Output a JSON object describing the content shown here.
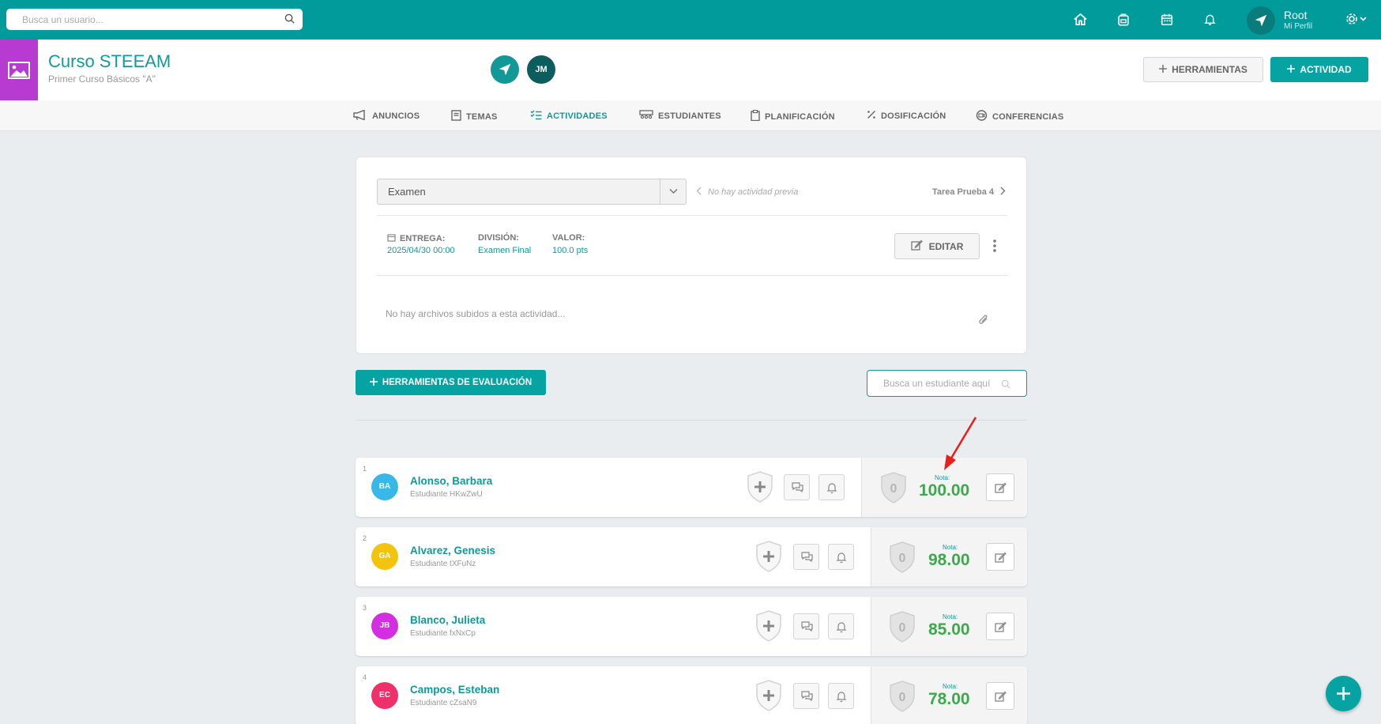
{
  "topbar": {
    "search_placeholder": "Busca un usuario...",
    "user_name": "Root",
    "user_sub": "Mi Perfil",
    "icons": [
      "home-icon",
      "backpack-icon",
      "calendar-icon",
      "bell-icon"
    ]
  },
  "course": {
    "title": "Curso STEEAM",
    "subtitle": "Primer Curso Básicos \"A\"",
    "member_initials": "JM",
    "tools_label": "HERRAMIENTAS",
    "activity_label": "ACTIVIDAD"
  },
  "tabs": [
    {
      "label": "ANUNCIOS",
      "icon": "megaphone-icon"
    },
    {
      "label": "TEMAS",
      "icon": "book-icon"
    },
    {
      "label": "ACTIVIDADES",
      "icon": "checklist-icon",
      "active": true
    },
    {
      "label": "ESTUDIANTES",
      "icon": "students-icon"
    },
    {
      "label": "PLANIFICACIÓN",
      "icon": "clipboard-icon"
    },
    {
      "label": "DOSIFICACIÓN",
      "icon": "percent-icon"
    },
    {
      "label": "CONFERENCIAS",
      "icon": "video-icon"
    }
  ],
  "activity": {
    "type_selected": "Examen",
    "prev_text": "No hay actividad previa",
    "next_text": "Tarea Prueba 4",
    "entrega_label": "ENTREGA:",
    "entrega_value": "2025/04/30 00:00",
    "division_label": "DIVISIÓN:",
    "division_value": "Examen Final",
    "valor_label": "VALOR:",
    "valor_value": "100.0 pts",
    "edit_label": "EDITAR",
    "no_files": "No hay archivos subidos a esta actividad..."
  },
  "evaluation": {
    "tools_label": "HERRAMIENTAS DE EVALUACIÓN",
    "search_placeholder": "Busca un estudiante aquí"
  },
  "students": [
    {
      "num": "1",
      "initials": "BA",
      "color": "#38b8e8",
      "name": "Alonso, Barbara",
      "id": "Estudiante HKwZwU",
      "badge": "0",
      "nota_label": "Nota:",
      "grade": "100.00"
    },
    {
      "num": "2",
      "initials": "GA",
      "color": "#f2c40f",
      "name": "Alvarez, Genesis",
      "id": "Estudiante tXFuNz",
      "badge": "0",
      "nota_label": "Nota:",
      "grade": "98.00"
    },
    {
      "num": "3",
      "initials": "JB",
      "color": "#d32ee0",
      "name": "Blanco, Julieta",
      "id": "Estudiante fxNxCp",
      "badge": "0",
      "nota_label": "Nota:",
      "grade": "85.00"
    },
    {
      "num": "4",
      "initials": "EC",
      "color": "#f0306b",
      "name": "Campos, Esteban",
      "id": "Estudiante cZsaN9",
      "badge": "0",
      "nota_label": "Nota:",
      "grade": "78.00"
    }
  ],
  "colors": {
    "primary": "#019b9b",
    "accent": "#06a3a3",
    "grade_green": "#3ea84c",
    "course_purple": "#b83bd1",
    "annotation_red": "#e8201b"
  }
}
